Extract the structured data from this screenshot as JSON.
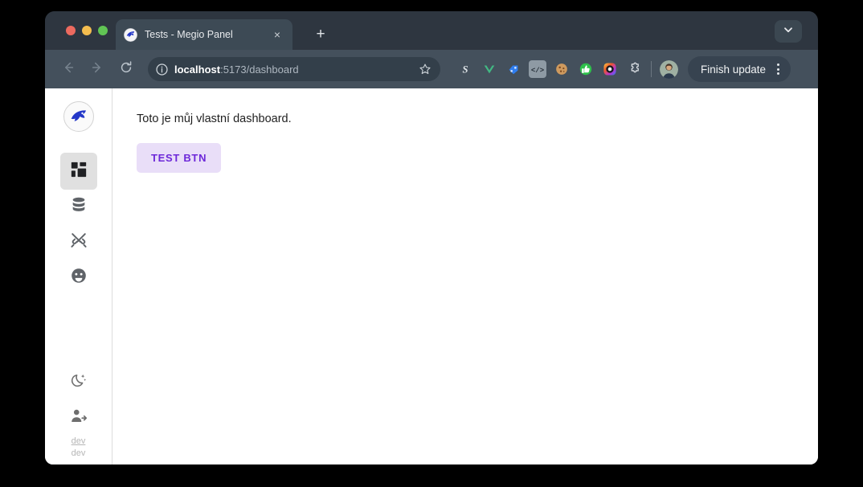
{
  "browser": {
    "tab": {
      "title": "Tests - Megio Panel",
      "favicon": "shark-logo-icon",
      "close_label": "×"
    },
    "new_tab_label": "+",
    "tab_search_icon": "chevron-down-icon",
    "nav": {
      "back_icon": "arrow-left-icon",
      "forward_icon": "arrow-right-icon",
      "reload_icon": "reload-icon"
    },
    "omnibox": {
      "site_info_icon": "info-circle-icon",
      "url_host": "localhost",
      "url_path": ":5173/dashboard",
      "bookmark_icon": "star-icon"
    },
    "extensions": [
      {
        "name": "s-extension-icon",
        "glyph": "S",
        "color": "#d7dbdf"
      },
      {
        "name": "vue-devtools-icon",
        "glyph": "V",
        "color": "#42b883"
      },
      {
        "name": "tag-extension-icon",
        "glyph": "◆",
        "color": "#3b82f6"
      },
      {
        "name": "code-extension-icon",
        "glyph": "</>",
        "color": "#3c4a55"
      },
      {
        "name": "cookie-extension-icon",
        "glyph": "●",
        "color": "#c98a4b"
      },
      {
        "name": "thumbs-up-extension-icon",
        "glyph": "👍",
        "color": "#34c759"
      },
      {
        "name": "gradient-circle-extension-icon",
        "glyph": "◉",
        "color": "#f06292"
      },
      {
        "name": "puzzle-extensions-icon",
        "glyph": "⌘",
        "color": "#e8eaed"
      }
    ],
    "profile": {
      "avatar_name": "user-avatar"
    },
    "update_button": {
      "label": "Finish update",
      "menu_icon": "kebab-menu-icon"
    }
  },
  "sidebar": {
    "logo_name": "megio-shark-logo",
    "items": [
      {
        "name": "sidebar-item-dashboard",
        "icon": "grid-dashboard-icon",
        "active": true
      },
      {
        "name": "sidebar-item-database",
        "icon": "database-icon",
        "active": false
      },
      {
        "name": "sidebar-item-tools",
        "icon": "tools-icon",
        "active": false
      },
      {
        "name": "sidebar-item-profile",
        "icon": "face-avatar-icon",
        "active": false
      }
    ],
    "bottom_items": [
      {
        "name": "sidebar-item-dark-mode",
        "icon": "moon-stars-icon"
      },
      {
        "name": "sidebar-item-logout",
        "icon": "person-arrow-icon"
      }
    ],
    "dev_link_label": "dev",
    "dev_text_label": "dev"
  },
  "main": {
    "headline": "Toto je můj vlastní dashboard.",
    "test_button_label": "TEST BTN",
    "accent_color": "#6d28d9",
    "test_button_bg": "#e9def8"
  }
}
